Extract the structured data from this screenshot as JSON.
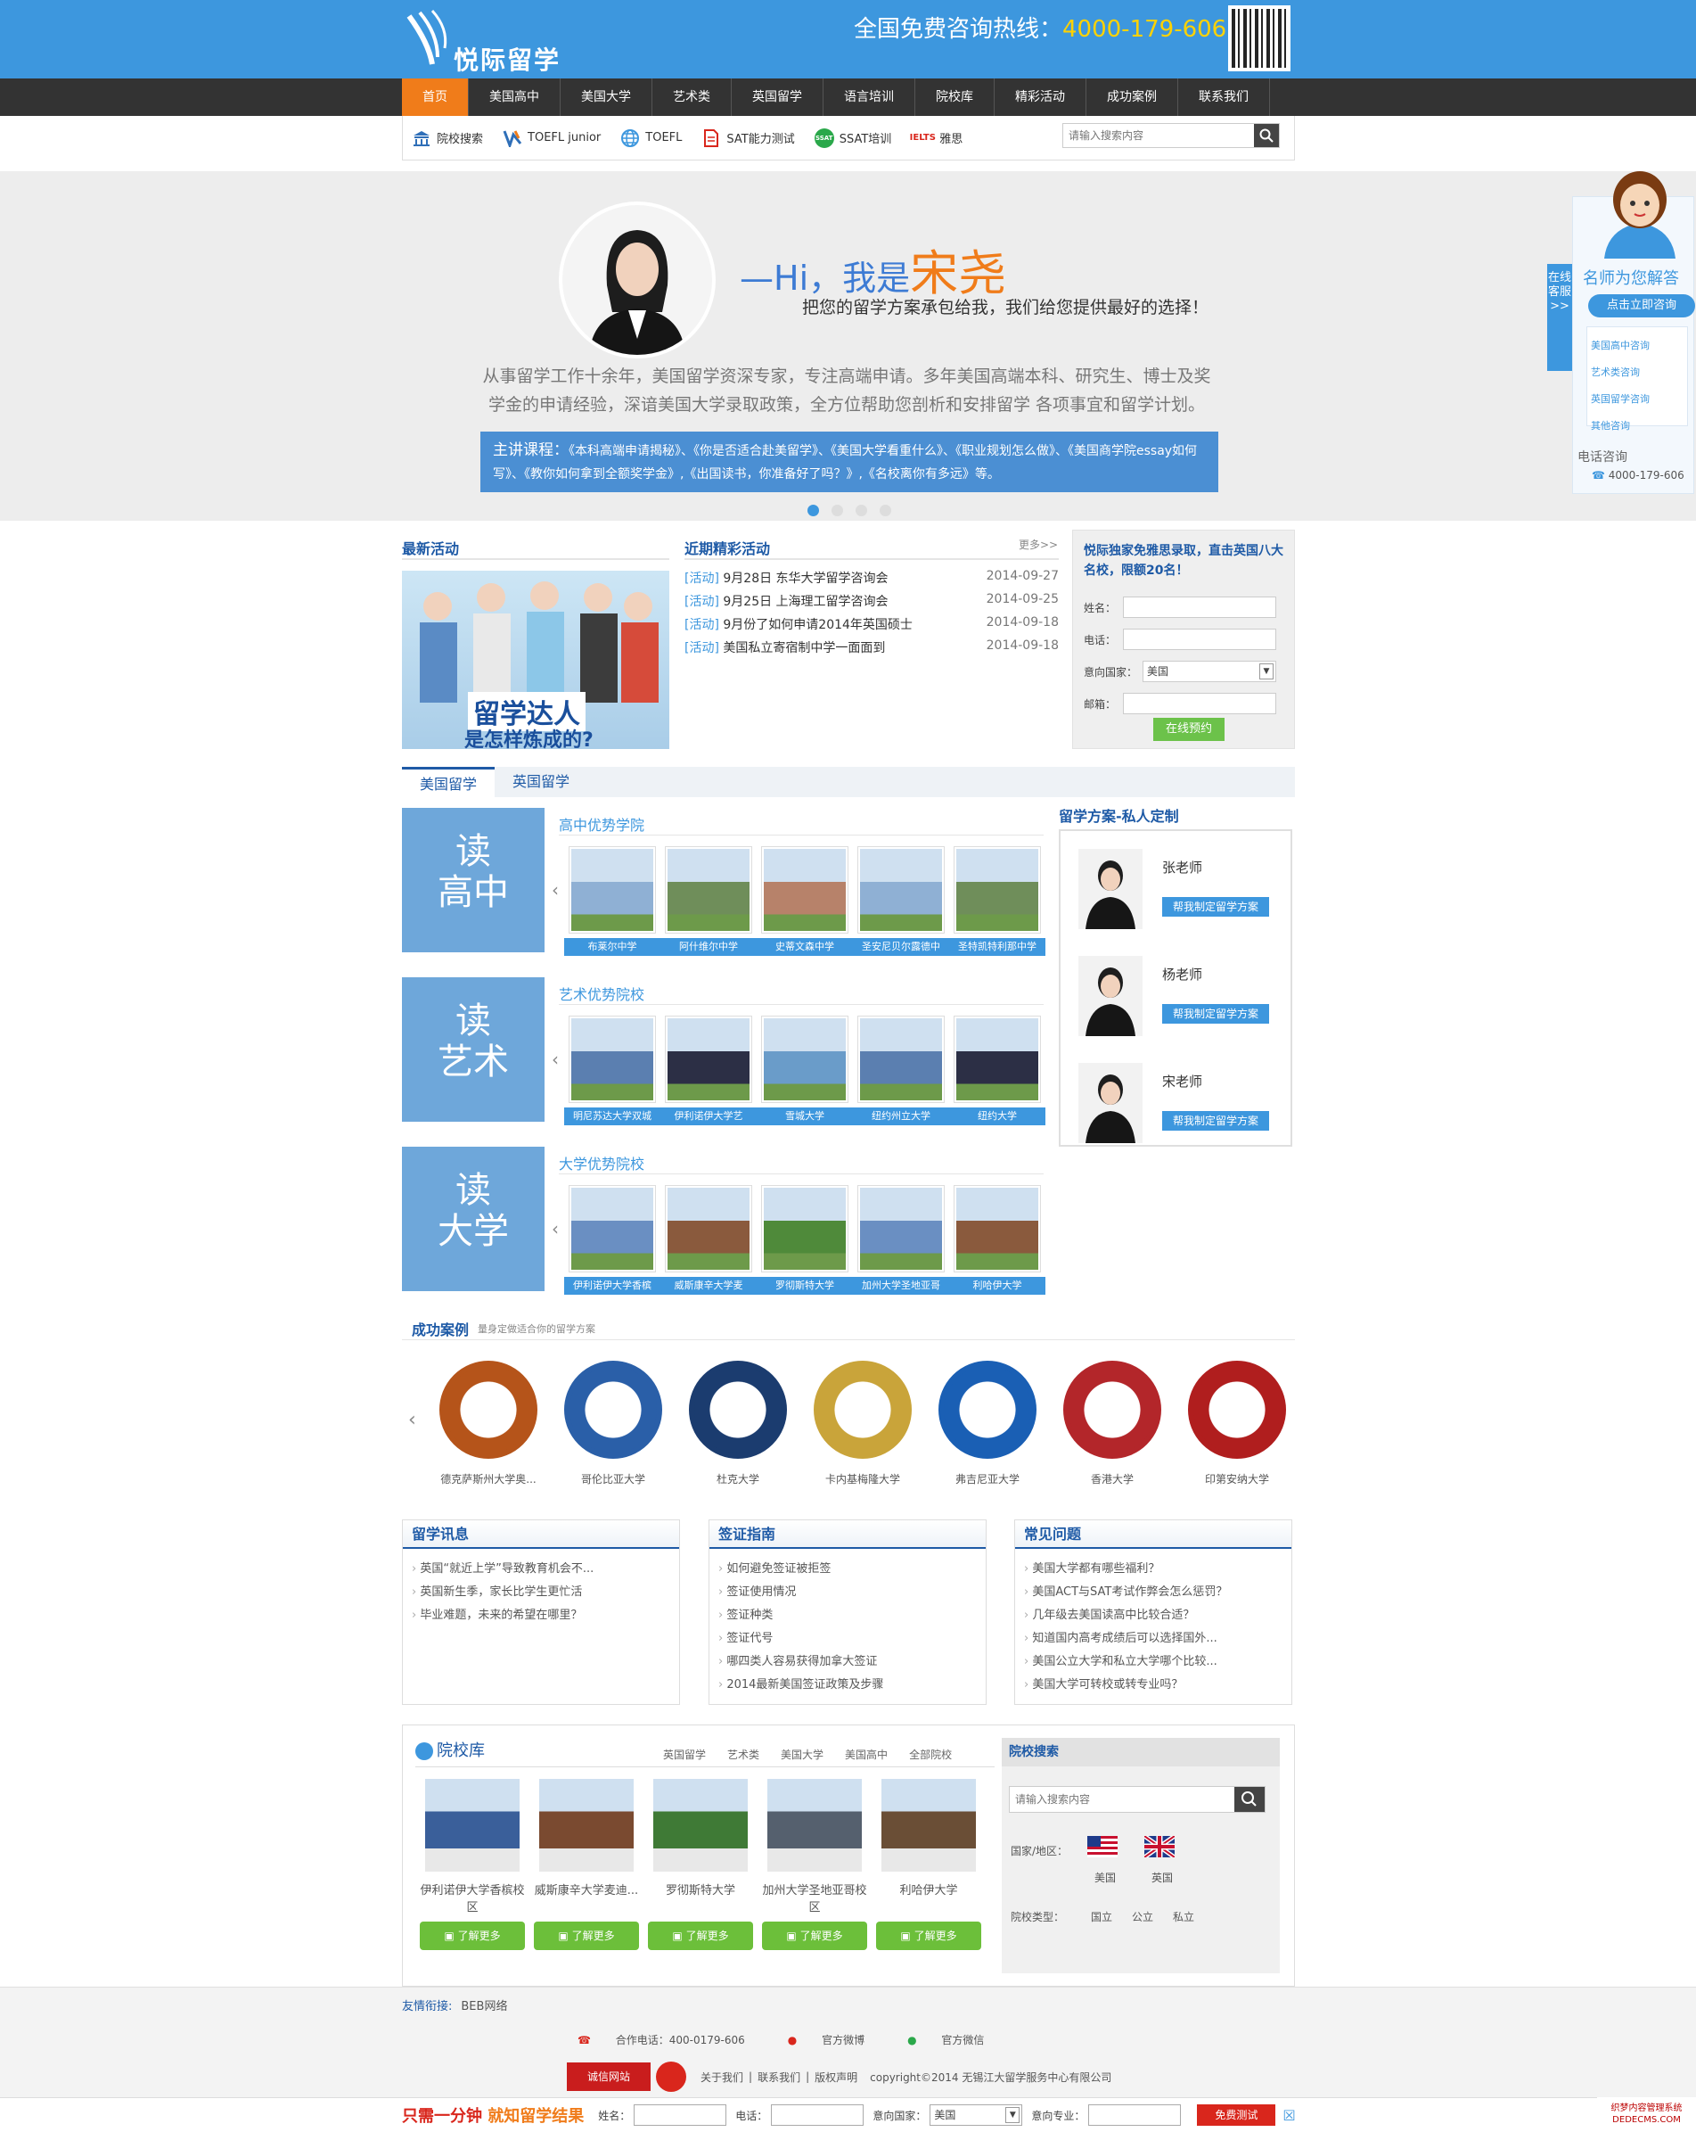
{
  "header": {
    "logo_text": "悦际留学",
    "hotline_label": "全国免费咨询热线：",
    "hotline_number": "4000-179-606"
  },
  "nav": [
    "首页",
    "美国高中",
    "美国大学",
    "艺术类",
    "英国留学",
    "语言培训",
    "院校库",
    "精彩活动",
    "成功案例",
    "联系我们"
  ],
  "quicklinks": [
    {
      "label": "院校搜索",
      "icon": "building-icon"
    },
    {
      "label": "TOEFL junior",
      "icon": "toefl-junior-icon"
    },
    {
      "label": "TOEFL",
      "icon": "globe-icon"
    },
    {
      "label": "SAT能力测试",
      "icon": "sat-icon"
    },
    {
      "label": "SSAT培训",
      "icon": "ssat-icon"
    },
    {
      "label": "雅思",
      "icon": "ielts-icon"
    }
  ],
  "quick_badges": {
    "ssat": "SSAT",
    "ielts": "IELTS"
  },
  "search": {
    "placeholder": "请输入搜索内容"
  },
  "banner": {
    "hi_prefix": "—Hi，我是",
    "name": "宋尧",
    "sub": "把您的留学方案承包给我，我们给您提供最好的选择！",
    "intro": "从事留学工作十余年，美国留学资深专家，专注高端申请。多年美国高端本科、研究生、博士及奖学金的申请经验，深谙美国大学录取政策，全方位帮助您剖析和安排留学 各项事宜和留学计划。",
    "course_lead": "主讲课程：",
    "courses": "《本科高端申请揭秘》、《你是否适合赴美留学》、《美国大学看重什么》、《职业规划怎么做》、《美国商学院essay如何写》、《教你如何拿到全额奖学金》,《出国读书，你准备好了吗？》,《名校离你有多远》等。"
  },
  "kefu": {
    "tab": "在线客服>>",
    "title": "名师为您解答",
    "cta": "点击立即咨询",
    "links": [
      "美国高中咨询",
      "艺术类咨询",
      "英国留学咨询",
      "其他咨询"
    ],
    "tel_label": "电话咨询",
    "tel": "4000-179-606"
  },
  "latest": {
    "title": "最新活动",
    "img_line1": "留学达人",
    "img_line2": "是怎样炼成的?"
  },
  "events": {
    "title": "近期精彩活动",
    "more": "更多>>",
    "items": [
      {
        "tag": "[活动]",
        "text": "9月28日 东华大学留学咨询会",
        "date": "2014-09-27"
      },
      {
        "tag": "[活动]",
        "text": "9月25日 上海理工留学咨询会",
        "date": "2014-09-25"
      },
      {
        "tag": "[活动]",
        "text": "9月份了如何申请2014年英国硕士",
        "date": "2014-09-18"
      },
      {
        "tag": "[活动]",
        "text": "美国私立寄宿制中学一面面到",
        "date": "2014-09-18"
      }
    ]
  },
  "form": {
    "heading": "悦际独家免雅思录取，直击英国八大名校，限额20名！",
    "name_label": "姓名：",
    "phone_label": "电话：",
    "country_label": "意向国家：",
    "country_value": "美国",
    "email_label": "邮箱：",
    "submit": "在线预约"
  },
  "tabs": [
    "美国留学",
    "英国留学"
  ],
  "rows": [
    {
      "big": [
        "读",
        "高中"
      ],
      "sub": "高中优势学院",
      "items": [
        "布莱尔中学",
        "阿什维尔中学",
        "史蒂文森中学",
        "圣安尼贝尔露德中",
        "圣特凯特利那中学"
      ]
    },
    {
      "big": [
        "读",
        "艺术"
      ],
      "sub": "艺术优势院校",
      "items": [
        "明尼苏达大学双城",
        "伊利诺伊大学艺",
        "雪城大学",
        "纽约州立大学",
        "纽约大学"
      ]
    },
    {
      "big": [
        "读",
        "大学"
      ],
      "sub": "大学优势院校",
      "items": [
        "伊利诺伊大学香槟",
        "威斯康辛大学麦",
        "罗彻斯特大学",
        "加州大学圣地亚哥",
        "利哈伊大学"
      ]
    }
  ],
  "teachers": {
    "title": "留学方案-私人定制",
    "items": [
      {
        "name": "张老师",
        "btn": "帮我制定留学方案"
      },
      {
        "name": "杨老师",
        "btn": "帮我制定留学方案"
      },
      {
        "name": "宋老师",
        "btn": "帮我制定留学方案"
      }
    ]
  },
  "success": {
    "title": "成功案例",
    "sub": "量身定做适合你的留学方案",
    "logos": [
      {
        "name": "德克萨斯州大学奥...",
        "color": "#b5541a"
      },
      {
        "name": "哥伦比亚大学",
        "color": "#2a5fa8"
      },
      {
        "name": "杜克大学",
        "color": "#1b3c6f"
      },
      {
        "name": "卡内基梅隆大学",
        "color": "#c9a43a"
      },
      {
        "name": "弗吉尼亚大学",
        "color": "#1a5fb4"
      },
      {
        "name": "香港大学",
        "color": "#b3262a"
      },
      {
        "name": "印第安纳大学",
        "color": "#b01e1e"
      }
    ]
  },
  "boxes": [
    {
      "title": "留学讯息",
      "items": [
        "英国“就近上学”导致教育机会不...",
        "英国新生季，家长比学生更忙活",
        "毕业难题，未来的希望在哪里？"
      ]
    },
    {
      "title": "签证指南",
      "items": [
        "如何避免签证被拒签",
        "签证使用情况",
        "签证种类",
        "签证代号",
        "哪四类人容易获得加拿大签证",
        "2014最新美国签证政策及步骤"
      ]
    },
    {
      "title": "常见问题",
      "items": [
        "美国大学都有哪些福利？",
        "美国ACT与SAT考试作弊会怎么惩罚？",
        "几年级去美国读高中比较合适？",
        "知道国内高考成绩后可以选择国外...",
        "美国公立大学和私立大学哪个比较...",
        "美国大学可转校或转专业吗？"
      ]
    }
  ],
  "library": {
    "title": "院校库",
    "tabs": [
      "英国留学",
      "艺术类",
      "美国大学",
      "美国高中",
      "全部院校"
    ],
    "items": [
      {
        "name": "伊利诺伊大学香槟校区",
        "btn": "了解更多"
      },
      {
        "name": "威斯康辛大学麦迪...",
        "btn": "了解更多"
      },
      {
        "name": "罗彻斯特大学",
        "btn": "了解更多"
      },
      {
        "name": "加州大学圣地亚哥校区",
        "btn": "了解更多"
      },
      {
        "name": "利哈伊大学",
        "btn": "了解更多"
      }
    ],
    "side_title": "院校搜索",
    "side_placeholder": "请输入搜索内容",
    "region_label": "国家/地区：",
    "us": "美国",
    "uk": "英国",
    "type_label": "院校类型：",
    "types": [
      "国立",
      "公立",
      "私立"
    ]
  },
  "footer": {
    "links_label": "友情衔接:",
    "links": "BEB网络",
    "tel": "合作电话：400-0179-606",
    "weibo": "官方微博",
    "weixin": "官方微信",
    "xin": "诚信网站",
    "about": "关于我们",
    "contact": "联系我们",
    "rights": "版权声明",
    "copyright": "copyright©2014 无锡江大留学服务中心有限公司"
  },
  "bottombar": {
    "slogan_a": "只需一分钟",
    "slogan_b": "就知留学结果",
    "name": "姓名：",
    "phone": "电话：",
    "country": "意向国家：",
    "country_value": "美国",
    "major": "意向专业：",
    "go": "免费测试"
  },
  "watermark": "织梦内容管理系统 DEDECMS.COM"
}
